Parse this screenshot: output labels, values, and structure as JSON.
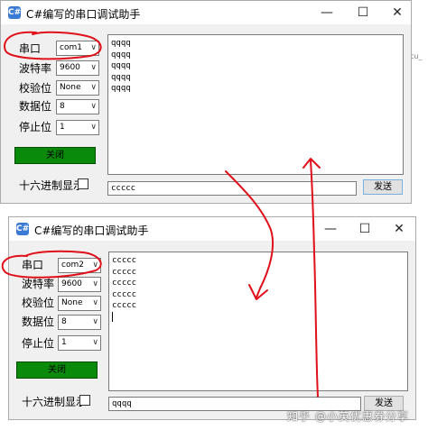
{
  "background": {
    "partial_text": "cu_"
  },
  "windows": [
    {
      "title": "C#编写的串口调试助手",
      "icon_label": "C#",
      "controls": {
        "minimize": "—",
        "maximize": "☐",
        "close": "✕"
      },
      "fields": [
        {
          "label": "串口",
          "value": "com1"
        },
        {
          "label": "波特率",
          "value": "9600"
        },
        {
          "label": "校验位",
          "value": "None"
        },
        {
          "label": "数据位",
          "value": "8"
        },
        {
          "label": "停止位",
          "value": "1"
        }
      ],
      "toggle_button": "关闭",
      "hex_label": "十六进制显示",
      "receive_lines": [
        "qqqq",
        "qqqq",
        "qqqq",
        "qqqq",
        "qqqq"
      ],
      "send_text": "ccccc",
      "send_button": "发送"
    },
    {
      "title": "C#编写的串口调试助手",
      "icon_label": "C#",
      "controls": {
        "minimize": "—",
        "maximize": "☐",
        "close": "✕"
      },
      "fields": [
        {
          "label": "串口",
          "value": "com2"
        },
        {
          "label": "波特率",
          "value": "9600"
        },
        {
          "label": "校验位",
          "value": "None"
        },
        {
          "label": "数据位",
          "value": "8"
        },
        {
          "label": "停止位",
          "value": "1"
        }
      ],
      "toggle_button": "关闭",
      "hex_label": "十六进制显示",
      "receive_lines": [
        "ccccc",
        "ccccc",
        "ccccc",
        "ccccc",
        "ccccc"
      ],
      "send_text": "qqqq",
      "send_button": "发送"
    }
  ],
  "watermark": "知乎 @小英优惠券分享",
  "annotation_color": "#e0101a"
}
